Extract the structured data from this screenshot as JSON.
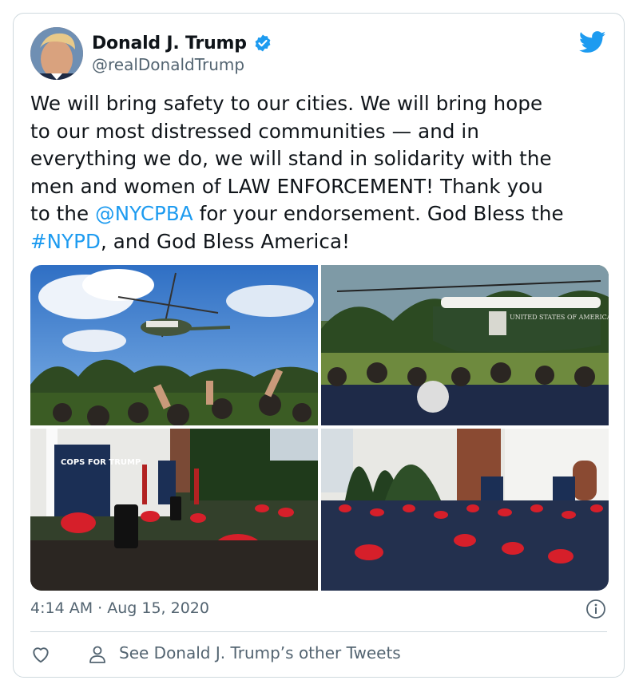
{
  "tweet": {
    "author": {
      "display_name": "Donald J. Trump",
      "handle": "@realDonaldTrump",
      "verified": true,
      "avatar_icon": "avatar-photo"
    },
    "text_lines": [
      {
        "segments": [
          {
            "t": "We will bring safety to our cities. We will bring hope"
          }
        ]
      },
      {
        "segments": [
          {
            "t": "to our most distressed communities — and in"
          }
        ]
      },
      {
        "segments": [
          {
            "t": "everything we do, we will stand in solidarity with the"
          }
        ]
      },
      {
        "segments": [
          {
            "t": "men and women of LAW ENFORCEMENT! Thank you"
          }
        ]
      },
      {
        "segments": [
          {
            "t": "to the "
          },
          {
            "t": "@NYCPBA",
            "link": true
          },
          {
            "t": " for your endorsement. God Bless the"
          }
        ]
      },
      {
        "segments": [
          {
            "t": "#NYPD",
            "link": true
          },
          {
            "t": ", and God Bless America!"
          }
        ]
      }
    ],
    "timestamp": "4:14 AM · Aug 15, 2020",
    "footer": {
      "like_icon": "heart-icon",
      "other_tweets_label": "See Donald J. Trump’s other Tweets",
      "other_tweets_icon": "person-icon"
    },
    "media": {
      "photos": [
        {
          "name": "photo-helicopter-sky",
          "alt": ""
        },
        {
          "name": "photo-marine-one-landed",
          "alt": "",
          "helicopter_text": "UNITED STATES OF AMERICA"
        },
        {
          "name": "photo-crowd-stage-left",
          "alt": "",
          "sign_text": "COPS FOR TRUMP"
        },
        {
          "name": "photo-crowd-building",
          "alt": ""
        }
      ]
    },
    "colors": {
      "link": "#1d9bf0",
      "secondary_text": "#536471",
      "border": "#cfd9de",
      "verified_badge": "#1d9bf0",
      "twitter_brand": "#1d9bf0"
    }
  }
}
